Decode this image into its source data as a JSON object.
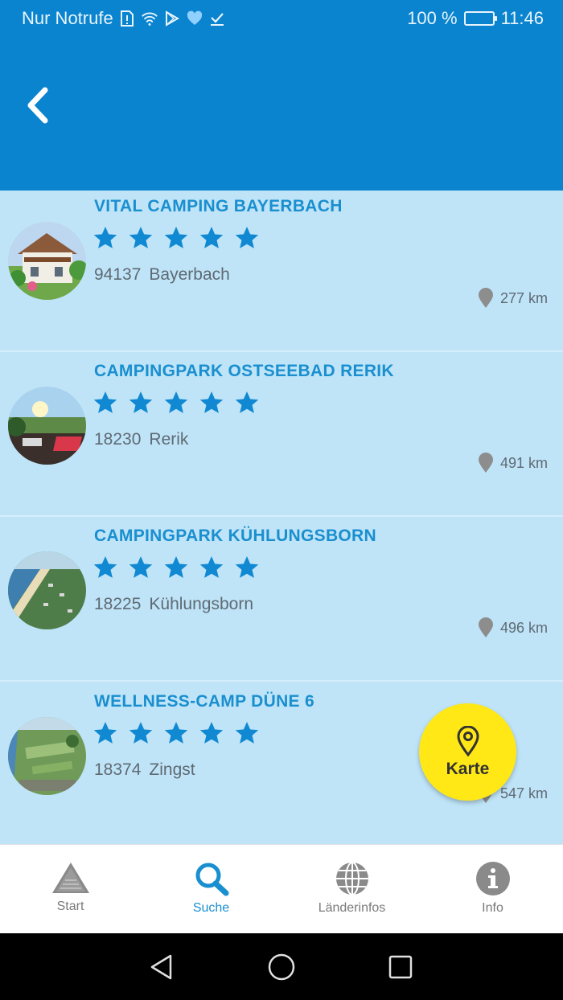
{
  "status_bar": {
    "carrier": "Nur Notrufe",
    "battery": "100 %",
    "time": "11:46"
  },
  "app_bar": {
    "back_icon": "chevron-left-icon"
  },
  "results": [
    {
      "name": "VITAL CAMPING BAYERBACH",
      "stars": 5,
      "zip": "94137",
      "city": "Bayerbach",
      "distance": "277 km"
    },
    {
      "name": "CAMPINGPARK OSTSEEBAD RERIK",
      "stars": 5,
      "zip": "18230",
      "city": "Rerik",
      "distance": "491 km"
    },
    {
      "name": "CAMPINGPARK KÜHLUNGSBORN",
      "stars": 5,
      "zip": "18225",
      "city": "Kühlungsborn",
      "distance": "496 km"
    },
    {
      "name": "WELLNESS-CAMP DÜNE 6",
      "stars": 5,
      "zip": "18374",
      "city": "Zingst",
      "distance": "547 km"
    }
  ],
  "fab": {
    "label": "Karte",
    "icon": "map-pin-icon"
  },
  "bottom_nav": [
    {
      "label": "Start",
      "icon": "triangle-logo-icon",
      "active": false
    },
    {
      "label": "Suche",
      "icon": "search-icon",
      "active": true
    },
    {
      "label": "Länderinfos",
      "icon": "globe-icon",
      "active": false
    },
    {
      "label": "Info",
      "icon": "info-icon",
      "active": false
    }
  ],
  "colors": {
    "primary": "#0a84cf",
    "list_bg": "#bfe4f8",
    "title": "#1a8fcf",
    "star": "#1089d2",
    "fab": "#ffe815"
  }
}
